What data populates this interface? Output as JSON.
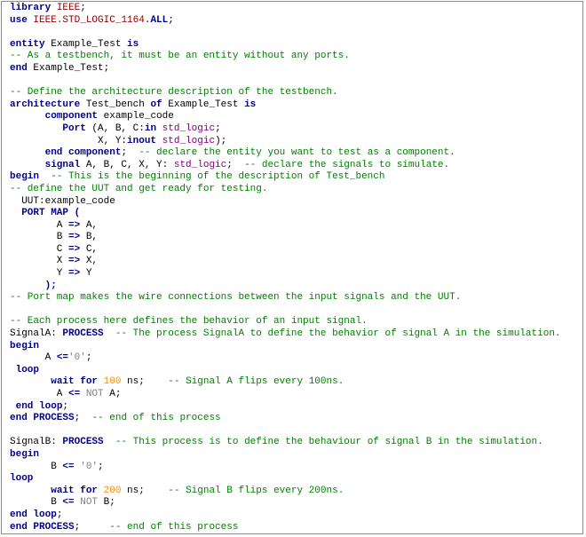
{
  "colors": {
    "keyword": "#00008b",
    "type": "#800080",
    "comment": "#008000",
    "number": "#ff8c00",
    "string": "#808080",
    "library": "#8b0000",
    "plain": "#000000"
  },
  "lines": [
    [
      [
        "kw",
        "library"
      ],
      [
        "pl",
        " "
      ],
      [
        "lib",
        "IEEE"
      ],
      [
        "pl",
        ";"
      ]
    ],
    [
      [
        "kw",
        "use"
      ],
      [
        "pl",
        " "
      ],
      [
        "lib",
        "IEEE.STD_LOGIC_1164"
      ],
      [
        "pl",
        "."
      ],
      [
        "kw",
        "ALL"
      ],
      [
        "pl",
        ";"
      ]
    ],
    [],
    [
      [
        "kw",
        "entity"
      ],
      [
        "pl",
        " Example_Test "
      ],
      [
        "kw",
        "is"
      ]
    ],
    [
      [
        "cmt",
        "-- As a testbench, it must be an entity without any ports."
      ]
    ],
    [
      [
        "kw",
        "end"
      ],
      [
        "pl",
        " Example_Test;"
      ]
    ],
    [],
    [
      [
        "cmt",
        "-- Define the architecture description of the testbench."
      ]
    ],
    [
      [
        "kw",
        "architecture"
      ],
      [
        "pl",
        " Test_bench "
      ],
      [
        "kw",
        "of"
      ],
      [
        "pl",
        " Example_Test "
      ],
      [
        "kw",
        "is"
      ]
    ],
    [
      [
        "pl",
        "      "
      ],
      [
        "kw",
        "component"
      ],
      [
        "pl",
        " example_code"
      ]
    ],
    [
      [
        "pl",
        "         "
      ],
      [
        "kw",
        "Port"
      ],
      [
        "pl",
        " ("
      ],
      [
        "pl",
        "A, B, C:"
      ],
      [
        "kw",
        "in"
      ],
      [
        "pl",
        " "
      ],
      [
        "typ",
        "std_logic"
      ],
      [
        "pl",
        ";"
      ]
    ],
    [
      [
        "pl",
        "               X, Y:"
      ],
      [
        "kw",
        "inout"
      ],
      [
        "pl",
        " "
      ],
      [
        "typ",
        "std_logic"
      ],
      [
        "pl",
        ");"
      ]
    ],
    [
      [
        "pl",
        "      "
      ],
      [
        "kw",
        "end component"
      ],
      [
        "pl",
        ";  "
      ],
      [
        "cmt",
        "-- declare the entity you want to test as a component."
      ]
    ],
    [
      [
        "pl",
        "      "
      ],
      [
        "kw",
        "signal"
      ],
      [
        "pl",
        " A, B, C, X, Y: "
      ],
      [
        "typ",
        "std_logic"
      ],
      [
        "pl",
        ";  "
      ],
      [
        "cmt",
        "-- declare the signals to simulate."
      ]
    ],
    [
      [
        "kw",
        "begin"
      ],
      [
        "pl",
        "  "
      ],
      [
        "cmt",
        "-- This is the beginning of the description of Test_bench"
      ]
    ],
    [
      [
        "cmt",
        "-- define the UUT and get ready for testing."
      ]
    ],
    [
      [
        "pl",
        "  UUT:example_code"
      ]
    ],
    [
      [
        "pl",
        "  "
      ],
      [
        "kw",
        "PORT MAP"
      ],
      [
        "pl",
        " "
      ],
      [
        "kw",
        "("
      ]
    ],
    [
      [
        "pl",
        "        A "
      ],
      [
        "kw",
        "=>"
      ],
      [
        "pl",
        " A,"
      ]
    ],
    [
      [
        "pl",
        "        B "
      ],
      [
        "kw",
        "=>"
      ],
      [
        "pl",
        " B,"
      ]
    ],
    [
      [
        "pl",
        "        C "
      ],
      [
        "kw",
        "=>"
      ],
      [
        "pl",
        " C,"
      ]
    ],
    [
      [
        "pl",
        "        X "
      ],
      [
        "kw",
        "=>"
      ],
      [
        "pl",
        " X,"
      ]
    ],
    [
      [
        "pl",
        "        Y "
      ],
      [
        "kw",
        "=>"
      ],
      [
        "pl",
        " Y"
      ]
    ],
    [
      [
        "pl",
        "      "
      ],
      [
        "kw",
        ");"
      ]
    ],
    [
      [
        "cmt",
        "-- Port map makes the wire connections between the input signals and the UUT."
      ]
    ],
    [],
    [
      [
        "cmt",
        "-- Each process here defines the behavior of an input signal."
      ]
    ],
    [
      [
        "pl",
        "SignalA: "
      ],
      [
        "kw",
        "PROCESS"
      ],
      [
        "pl",
        "  "
      ],
      [
        "cmt",
        "-- The process SignalA to define the behavior of signal A in the simulation."
      ]
    ],
    [
      [
        "kw",
        "begin"
      ]
    ],
    [
      [
        "pl",
        "      A "
      ],
      [
        "kw",
        "<="
      ],
      [
        "str",
        "'0'"
      ],
      [
        "pl",
        ";"
      ]
    ],
    [
      [
        "pl",
        " "
      ],
      [
        "kw",
        "loop"
      ]
    ],
    [
      [
        "pl",
        "       "
      ],
      [
        "kw",
        "wait for"
      ],
      [
        "pl",
        " "
      ],
      [
        "num",
        "100"
      ],
      [
        "pl",
        " ns;    "
      ],
      [
        "cmt",
        "-- Signal A flips every 100ns."
      ]
    ],
    [
      [
        "pl",
        "        A "
      ],
      [
        "kw",
        "<="
      ],
      [
        "pl",
        " "
      ],
      [
        "str",
        "NOT"
      ],
      [
        "pl",
        " A;"
      ]
    ],
    [
      [
        "pl",
        " "
      ],
      [
        "kw",
        "end loop"
      ],
      [
        "pl",
        ";"
      ]
    ],
    [
      [
        "kw",
        "end PROCESS"
      ],
      [
        "pl",
        ";  "
      ],
      [
        "cmt",
        "-- end of this process"
      ]
    ],
    [],
    [
      [
        "pl",
        "SignalB: "
      ],
      [
        "kw",
        "PROCESS"
      ],
      [
        "pl",
        "  "
      ],
      [
        "cmt",
        "-- This process is to define the behaviour of signal B in the simulation."
      ]
    ],
    [
      [
        "kw",
        "begin"
      ]
    ],
    [
      [
        "pl",
        "       B "
      ],
      [
        "kw",
        "<="
      ],
      [
        "pl",
        " "
      ],
      [
        "str",
        "'0'"
      ],
      [
        "pl",
        ";"
      ]
    ],
    [
      [
        "kw",
        "loop"
      ]
    ],
    [
      [
        "pl",
        "       "
      ],
      [
        "kw",
        "wait for"
      ],
      [
        "pl",
        " "
      ],
      [
        "num",
        "200"
      ],
      [
        "pl",
        " ns;    "
      ],
      [
        "cmt",
        "-- Signal B flips every 200ns."
      ]
    ],
    [
      [
        "pl",
        "       B "
      ],
      [
        "kw",
        "<="
      ],
      [
        "pl",
        " "
      ],
      [
        "str",
        "NOT"
      ],
      [
        "pl",
        " B;"
      ]
    ],
    [
      [
        "kw",
        "end loop"
      ],
      [
        "pl",
        ";"
      ]
    ],
    [
      [
        "kw",
        "end PROCESS"
      ],
      [
        "pl",
        ";     "
      ],
      [
        "cmt",
        "-- end of this process"
      ]
    ]
  ]
}
